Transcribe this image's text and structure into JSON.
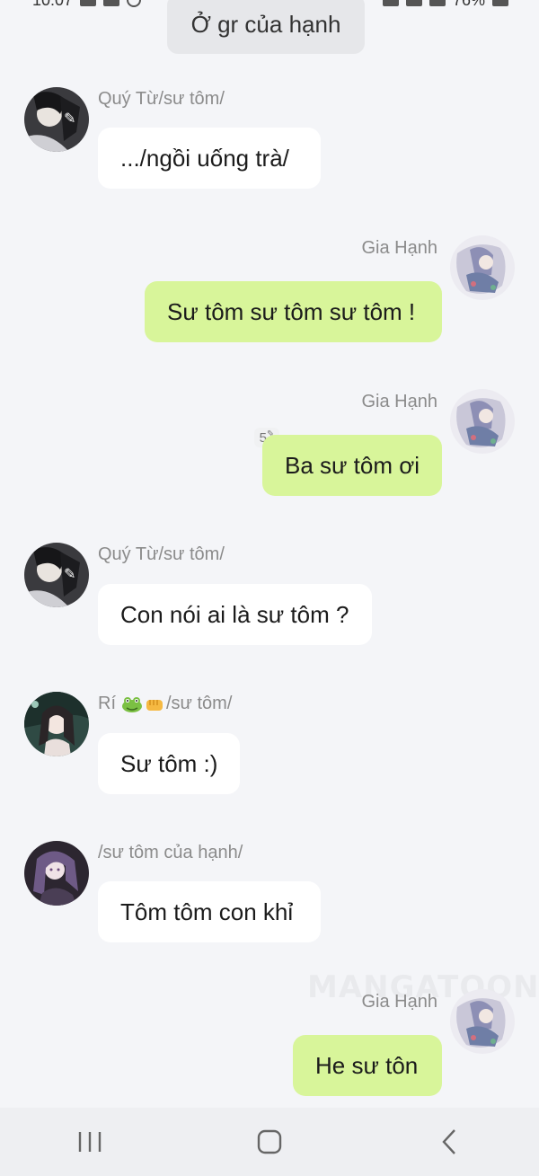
{
  "status_bar": {
    "time": "10:07",
    "battery": "76%"
  },
  "group_title": "Ở gr của hạnh",
  "messages": [
    {
      "sender": "Quý Từ/sư tôm/",
      "text": ".../ngồi uống trà/",
      "side": "in"
    },
    {
      "sender": "Gia Hạnh",
      "text": "Sư tôm sư tôm sư tôm !",
      "side": "out"
    },
    {
      "sender": "Gia Hạnh",
      "text": "Ba sư tôm ơi",
      "side": "out",
      "badge": "5"
    },
    {
      "sender": "Quý Từ/sư tôm/",
      "text": "Con nói ai là sư tôm ?",
      "side": "in"
    },
    {
      "sender_prefix": "Rí",
      "sender_suffix": "/sư tôm/",
      "sender_emoji": [
        "frog-emoji",
        "fist-emoji"
      ],
      "text": "Sư tôm :)",
      "side": "in"
    },
    {
      "sender": "/sư tôm của hạnh/",
      "text": "Tôm tôm con khỉ",
      "side": "in"
    },
    {
      "sender": "Gia Hạnh",
      "text": "He sư tôn",
      "side": "out"
    }
  ],
  "watermark": "MANGATOON",
  "nav": {
    "recents": "recents-icon",
    "home": "home-icon",
    "back": "back-icon"
  },
  "colors": {
    "background": "#f4f5f8",
    "incoming_bubble": "#ffffff",
    "outgoing_bubble": "#d8f59a",
    "name_text": "#8b8b8b"
  }
}
